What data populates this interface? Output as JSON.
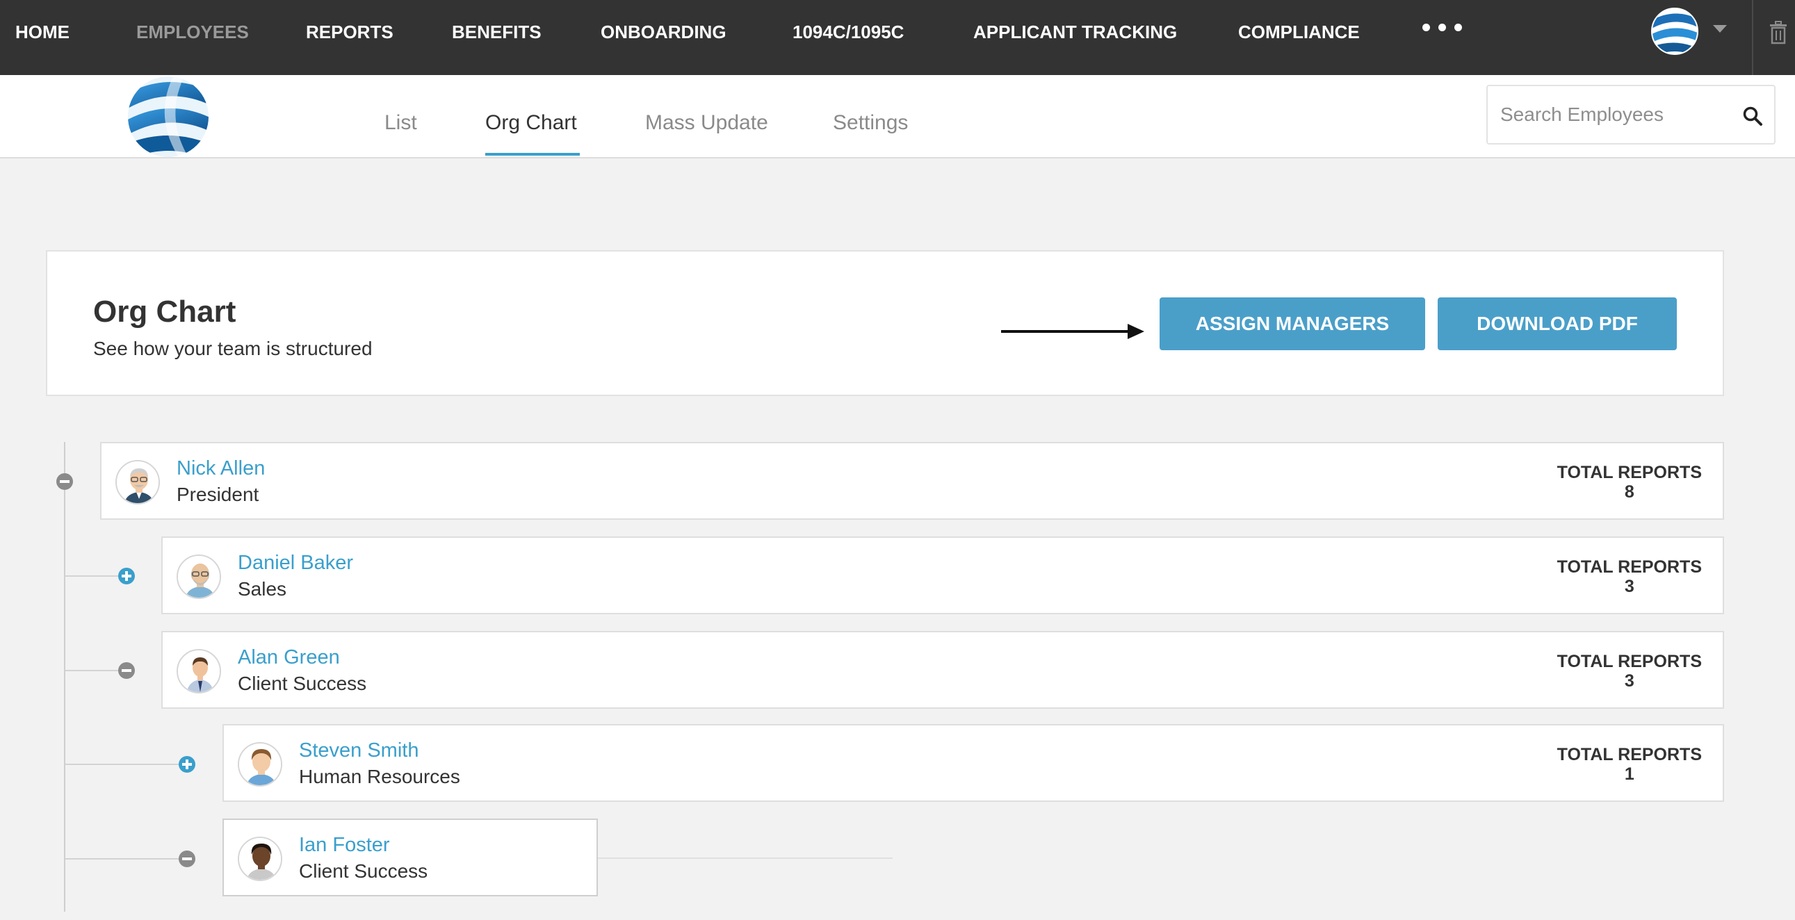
{
  "nav": {
    "items": [
      {
        "label": "HOME"
      },
      {
        "label": "EMPLOYEES"
      },
      {
        "label": "REPORTS"
      },
      {
        "label": "BENEFITS"
      },
      {
        "label": "ONBOARDING"
      },
      {
        "label": "1094C/1095C"
      },
      {
        "label": "APPLICANT TRACKING"
      },
      {
        "label": "COMPLIANCE"
      }
    ],
    "active": "EMPLOYEES"
  },
  "tabs": [
    {
      "label": "List"
    },
    {
      "label": "Org Chart"
    },
    {
      "label": "Mass Update"
    },
    {
      "label": "Settings"
    }
  ],
  "active_tab": "Org Chart",
  "search": {
    "placeholder": "Search Employees"
  },
  "header": {
    "title": "Org Chart",
    "subtitle": "See how your team is structured",
    "assign_label": "ASSIGN MANAGERS",
    "download_label": "DOWNLOAD PDF"
  },
  "reports_label": "TOTAL REPORTS",
  "employees": [
    {
      "name": "Nick Allen",
      "role": "President",
      "total_reports": "8",
      "toggle": "collapse"
    },
    {
      "name": "Daniel Baker",
      "role": "Sales",
      "total_reports": "3",
      "toggle": "expand"
    },
    {
      "name": "Alan Green",
      "role": "Client Success",
      "total_reports": "3",
      "toggle": "collapse"
    },
    {
      "name": "Steven Smith",
      "role": "Human Resources",
      "total_reports": "1",
      "toggle": "expand"
    },
    {
      "name": "Ian Foster",
      "role": "Client Success",
      "toggle": "collapse"
    }
  ],
  "colors": {
    "accent": "#4a9fc9",
    "link": "#3a9fcc",
    "nav_bg": "#333333",
    "page_bg": "#f2f2f2"
  }
}
